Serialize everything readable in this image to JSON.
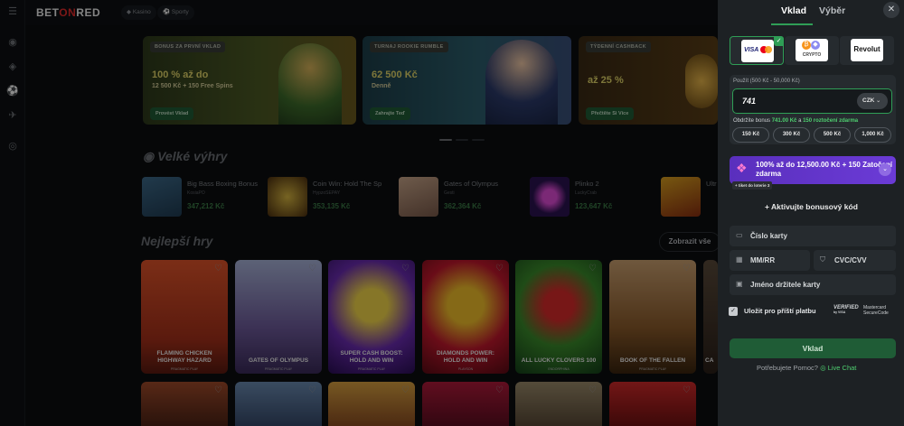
{
  "topbar": {
    "logo_pre": "BET",
    "logo_on": "ON",
    "logo_post": "RED",
    "nav": [
      "Kasino",
      "Sporty"
    ]
  },
  "banners": [
    {
      "tag": "BONUS ZA PRVNÍ VKLAD",
      "title": "100 % až do",
      "subtitle": "12 500 Kč + 150 Free Spins",
      "button": "Provést Vklad"
    },
    {
      "tag": "TURNAJ ROOKIE RUMBLE",
      "title": "62 500 Kč",
      "subtitle": "Denně",
      "button": "Zahrajte Teď"
    },
    {
      "tag": "TÝDENNÍ CASHBACK",
      "title": "až 25 %",
      "subtitle": "",
      "button": "Přečtěte Si Více"
    }
  ],
  "big_wins": {
    "title": "Velké výhry",
    "items": [
      {
        "game": "Big Bass Boxing Bonus",
        "user": "KosiaPO",
        "amount": "347,212 Kč"
      },
      {
        "game": "Coin Win: Hold The Sp",
        "user": "HypzoSEPAY",
        "amount": "353,135 Kč"
      },
      {
        "game": "Gates of Olympus",
        "user": "Gesti",
        "amount": "362,364 Kč"
      },
      {
        "game": "Plinko 2",
        "user": "LuckyCrab",
        "amount": "123,647 Kč"
      },
      {
        "game": "Ultr",
        "user": "",
        "amount": ""
      }
    ]
  },
  "best_games": {
    "title": "Nejlepší hry",
    "show_all": "Zobrazit vše",
    "items": [
      {
        "name": "FLAMING CHICKEN HIGHWAY HAZARD",
        "provider": "PRAGMATIC PLAY",
        "color": "#c0391f"
      },
      {
        "name": "GATES OF OLYMPUS",
        "provider": "PRAGMATIC PLAY",
        "color": "#7c6aa8"
      },
      {
        "name": "SUPER CASH BOOST: HOLD AND WIN",
        "provider": "PRAGMATIC PLAY",
        "color": "#5a1f96"
      },
      {
        "name": "DIAMONDS POWER: HOLD AND WIN",
        "provider": "PLAYSON",
        "color": "#b5182c"
      },
      {
        "name": "ALL LUCKY CLOVERS 100",
        "provider": "ENDORPHINA",
        "color": "#2f7a2a"
      },
      {
        "name": "BOOK OF THE FALLEN",
        "provider": "PRAGMATIC PLAY",
        "color": "#7c4b22"
      },
      {
        "name": "CA",
        "provider": "",
        "color": "#3a2f2a"
      }
    ]
  },
  "panel": {
    "tab_deposit": "Vklad",
    "tab_withdraw": "Výběr",
    "payment_methods": [
      {
        "name": "VISA / Mastercard",
        "selected": true
      },
      {
        "name": "CRYPTO",
        "selected": false
      },
      {
        "name": "Revolut",
        "selected": false
      }
    ],
    "amount_label": "Použít (500 Kč - 50,000 Kč)",
    "amount_value": "741",
    "currency": "CZK",
    "bonus_note_pre": "Obdržíte bonus",
    "bonus_amount": "741.00 Kč",
    "bonus_mid": "a",
    "bonus_spins": "150 roztočení zdarma",
    "quick_amounts": [
      "150 Kč",
      "300 Kč",
      "500 Kč",
      "1,000 Kč"
    ],
    "promo_title": "100% až do 12,500.00 Kč + 150 Zatočení zdarma",
    "promo_ticket": "+ tiket do loterie 3",
    "activate_bonus": "+ Aktivujte bonusový kód",
    "card_number": "Číslo karty",
    "expiry": "MM/RR",
    "cvc": "CVC/CVV",
    "holder": "Jméno držitele karty",
    "save_label": "Uložit pro příští platbu",
    "verified_by": "VERIFIED",
    "verified_sub": "by VISA",
    "mastercard_line1": "Mastercard",
    "mastercard_line2": "SecureCode",
    "deposit_button": "Vklad",
    "help_text": "Potřebujete Pomoc?",
    "live_chat": "Live Chat"
  },
  "colors": {
    "accent_green": "#2f9e56",
    "panel_bg": "#1d2124",
    "promo_purple": "#5a2fbd"
  }
}
